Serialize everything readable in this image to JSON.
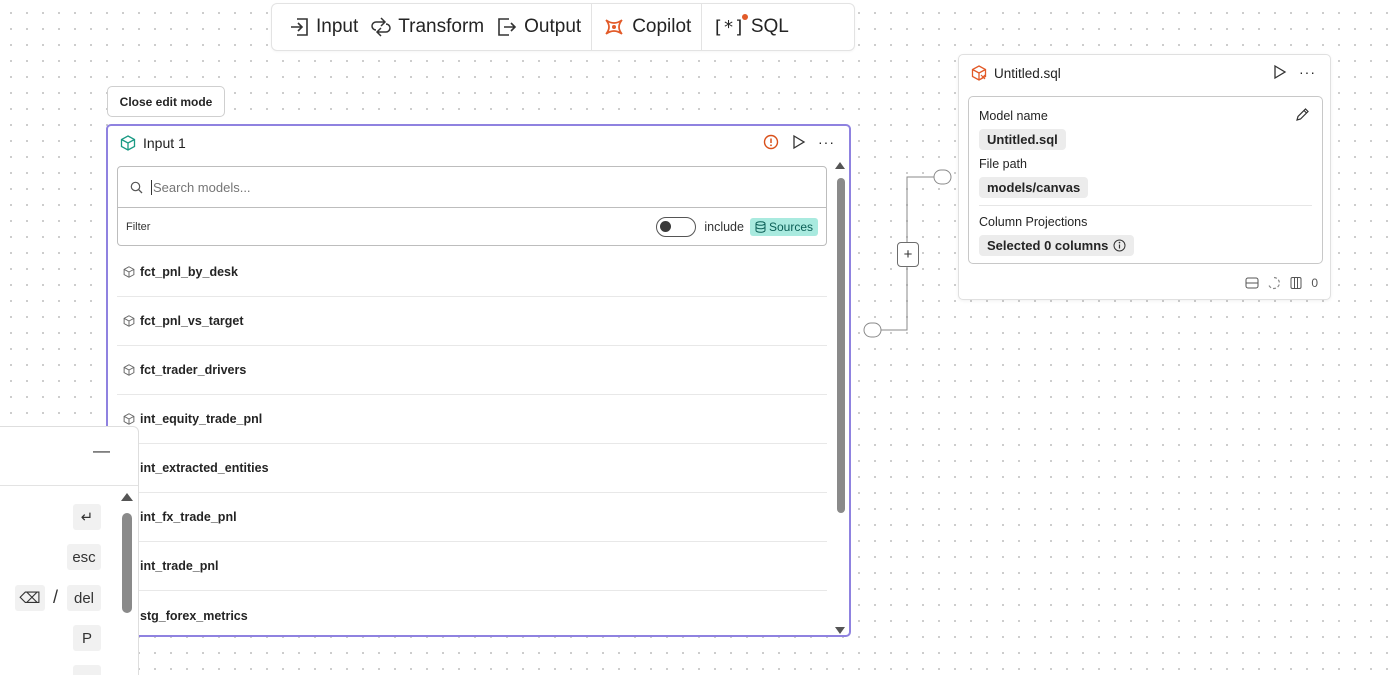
{
  "toolbar": {
    "input": "Input",
    "transform": "Transform",
    "output": "Output",
    "copilot": "Copilot",
    "sql": "SQL"
  },
  "close_edit": "Close edit mode",
  "input_card": {
    "title": "Input 1",
    "search_placeholder": "Search models...",
    "filter_label": "Filter",
    "include_label": "include",
    "sources_label": "Sources",
    "models": [
      "fct_pnl_by_desk",
      "fct_pnl_vs_target",
      "fct_trader_drivers",
      "int_equity_trade_pnl",
      "int_extracted_entities",
      "int_fx_trade_pnl",
      "int_trade_pnl",
      "stg_forex_metrics"
    ]
  },
  "sql_card": {
    "title": "Untitled.sql",
    "model_name_label": "Model name",
    "model_name_value": "Untitled.sql",
    "file_path_label": "File path",
    "file_path_value": "models/canvas",
    "column_projections_label": "Column Projections",
    "column_projections_value": "Selected 0 columns",
    "column_count": "0"
  },
  "cmd_panel": {
    "minimize": "—",
    "enter_key": "↵",
    "esc_key": "esc",
    "backspace_key": "⌫",
    "slash": "/",
    "del_key": "del",
    "p_key": "P"
  },
  "colors": {
    "accent_purple": "#8f82e0",
    "copilot_orange": "#e25a28",
    "sources_badge": "#a9eadf",
    "warning_orange": "#d9501a"
  }
}
